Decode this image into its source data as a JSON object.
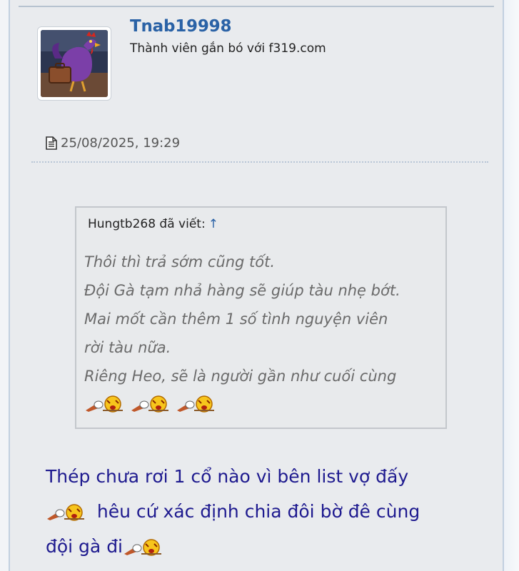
{
  "author": {
    "username": "Tnab19998",
    "title": "Thành viên gắn bó với f319.com",
    "avatar_icon": "rooster-with-suitcase-avatar"
  },
  "post": {
    "date_icon": "document-icon",
    "date": "25/08/2025, 19:29"
  },
  "quote": {
    "author_line": "Hungtb268 đã viết:",
    "arrow": "↑",
    "lines": [
      "Thôi thì trả sớm cũng tốt.",
      "Đội Gà tạm nhả hàng sẽ giúp tàu nhẹ bớt.",
      "Mai mốt cần thêm 1 số tình nguyện viên",
      "rời tàu nữa.",
      "Riêng Heo, sẽ là người gần như cuối cùng"
    ],
    "emoticons": [
      "knockout-emoticon",
      "knockout-emoticon",
      "knockout-emoticon"
    ]
  },
  "message": {
    "line1": "Thép chưa rơi 1 cổ nào vì bên list vợ đấy",
    "line2": "hêu cứ xác định chia đôi bờ đê cùng",
    "line3": "đội gà đi",
    "emoticon": "knockout-emoticon"
  },
  "colors": {
    "username": "#2a62a6",
    "message_text": "#1e1a8f",
    "quote_text": "#6a6a6a",
    "post_background": "#e9ebee"
  }
}
